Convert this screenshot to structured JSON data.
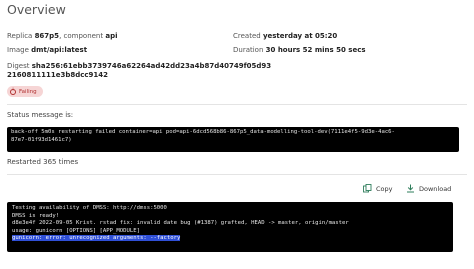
{
  "page": {
    "title": "Overview"
  },
  "overview": {
    "replica_label": "Replica",
    "replica_value": "867p5",
    "component_label": "component",
    "component_value": "api",
    "created_label": "Created",
    "created_value": "yesterday at 05:20",
    "image_label": "Image",
    "image_value": "dmt/api:latest",
    "duration_label": "Duration",
    "duration_value": "30 hours 52 mins 50 secs",
    "digest_label": "Digest",
    "digest_line1": "sha256:61ebb3739746a62264ad42dd23a4b87d40749f05d93",
    "digest_line2": "2160811111e3b8dcc9142",
    "status_badge": "Failing"
  },
  "status_section": {
    "label": "Status message is:",
    "message_line1": "back-off 5m0s restarting failed container=api pod=api-6dcd568b86-867p5_data-modelling-tool-dev(7111e4f5-9d3e-4ac6-",
    "message_line2": "87e7-01f93d1461c7)",
    "restart_text": "Restarted 365 times"
  },
  "log_section": {
    "copy_label": "Copy",
    "download_label": "Download",
    "lines": [
      "Testing availability of DMSS: http://dmss:5000",
      "DMSS is ready!",
      "d8e3e4f 2022-09-05 Krist. rstad fix: invalid date bug (#1387) grafted, HEAD -> master, origin/master",
      "usage: gunicorn [OPTIONS] [APP_MODULE]",
      "gunicorn: error: unrecognized arguments: --factory"
    ]
  },
  "colors": {
    "badge_bg": "#f6d5d5",
    "badge_text": "#b03030",
    "terminal_bg": "#000000",
    "selection_highlight": "#2f4fd6",
    "download_icon": "#2e7d5b"
  }
}
